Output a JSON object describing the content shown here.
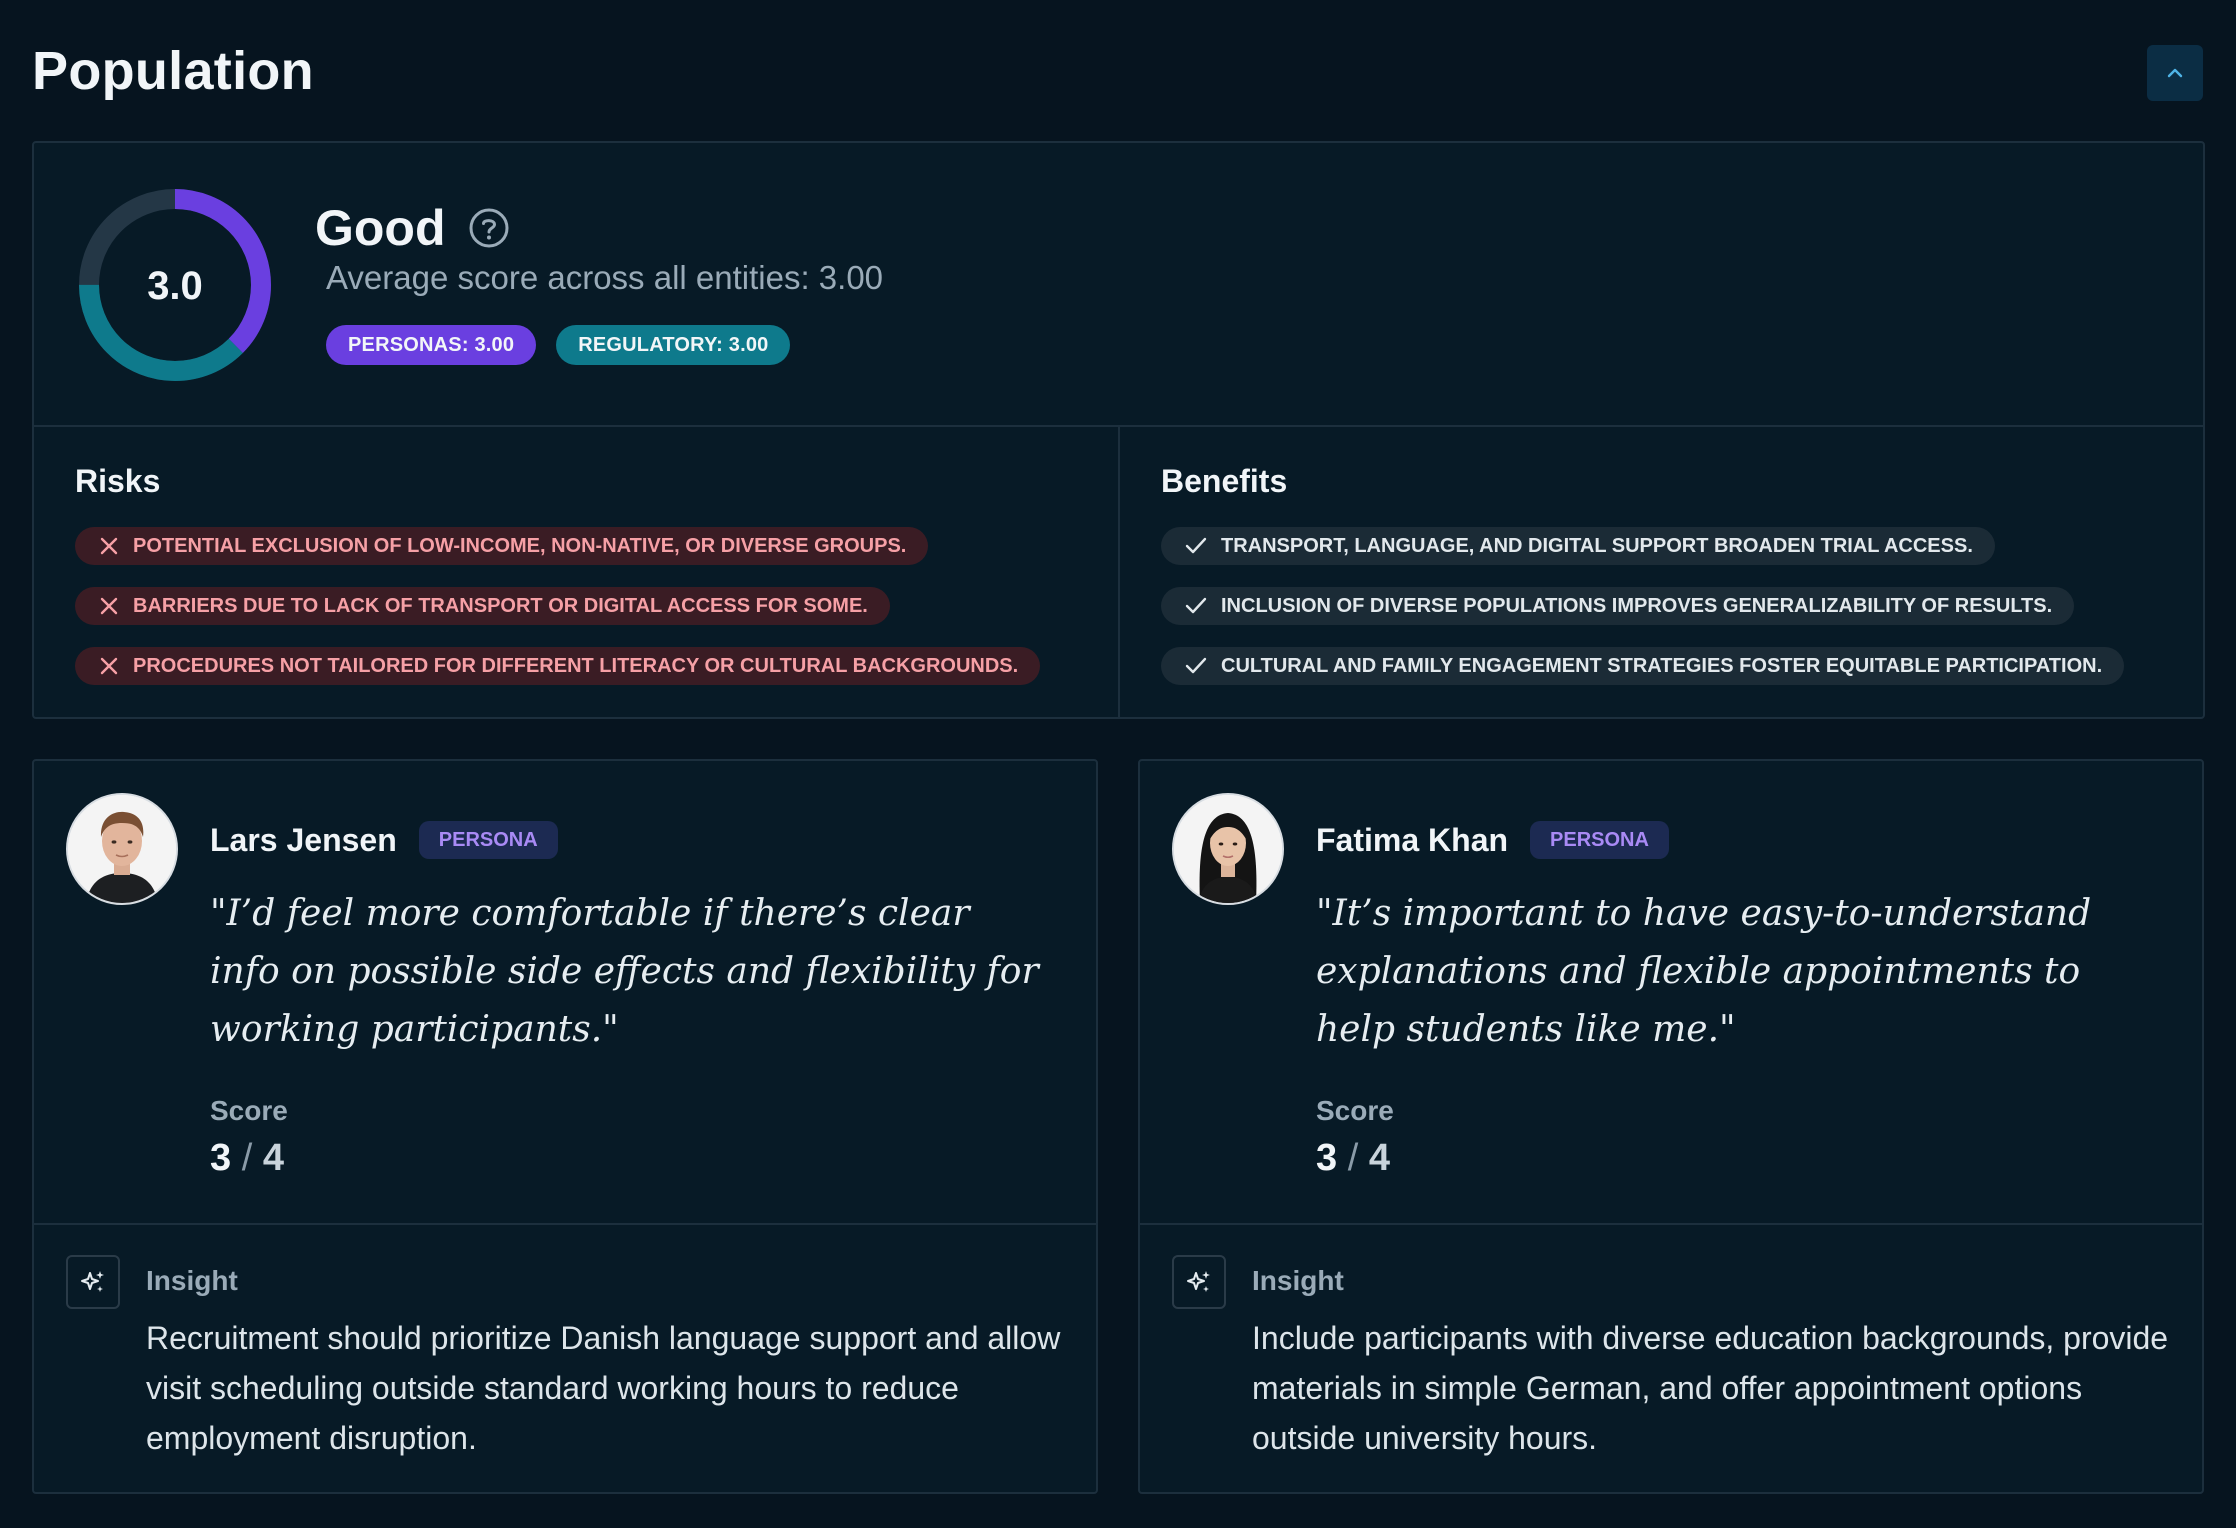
{
  "header": {
    "title": "Population"
  },
  "summary": {
    "score_value": "3.0",
    "score": 3.0,
    "score_max": 4,
    "rating": "Good",
    "average_text": "Average score across all entities: 3.00",
    "pills": [
      {
        "label": "PERSONAS: 3.00",
        "color": "#6a3fe0"
      },
      {
        "label": "REGULATORY: 3.00",
        "color": "#0e7a8c"
      }
    ],
    "donut_colors": {
      "personas": "#6a3fe0",
      "regulatory": "#0e7a8c",
      "track": "#243746"
    }
  },
  "risks": {
    "title": "Risks",
    "items": [
      "POTENTIAL EXCLUSION OF LOW-INCOME, NON-NATIVE, OR DIVERSE GROUPS.",
      "BARRIERS DUE TO LACK OF TRANSPORT OR DIGITAL ACCESS FOR SOME.",
      "PROCEDURES NOT TAILORED FOR DIFFERENT LITERACY OR CULTURAL BACKGROUNDS."
    ]
  },
  "benefits": {
    "title": "Benefits",
    "items": [
      "TRANSPORT, LANGUAGE, AND DIGITAL SUPPORT BROADEN TRIAL ACCESS.",
      "INCLUSION OF DIVERSE POPULATIONS IMPROVES GENERALIZABILITY OF RESULTS.",
      "CULTURAL AND FAMILY ENGAGEMENT STRATEGIES FOSTER EQUITABLE PARTICIPATION."
    ]
  },
  "personas": [
    {
      "name": "Lars Jensen",
      "badge": "PERSONA",
      "quote": "\"I’d feel more comfortable if there’s clear info on possible side effects and flexibility for working participants.\"",
      "score_label": "Score",
      "score": "3",
      "score_sep": "/",
      "score_max": "4",
      "insight_label": "Insight",
      "insight": "Recruitment should prioritize Danish language support and allow visit scheduling outside standard working hours to reduce employment disruption."
    },
    {
      "name": "Fatima Khan",
      "badge": "PERSONA",
      "quote": "\"It’s important to have easy-to-understand explanations and flexible appointments to help students like me.\"",
      "score_label": "Score",
      "score": "3",
      "score_sep": "/",
      "score_max": "4",
      "insight_label": "Insight",
      "insight": "Include participants with diverse education backgrounds, provide materials in simple German, and offer appointment options outside university hours."
    }
  ]
}
